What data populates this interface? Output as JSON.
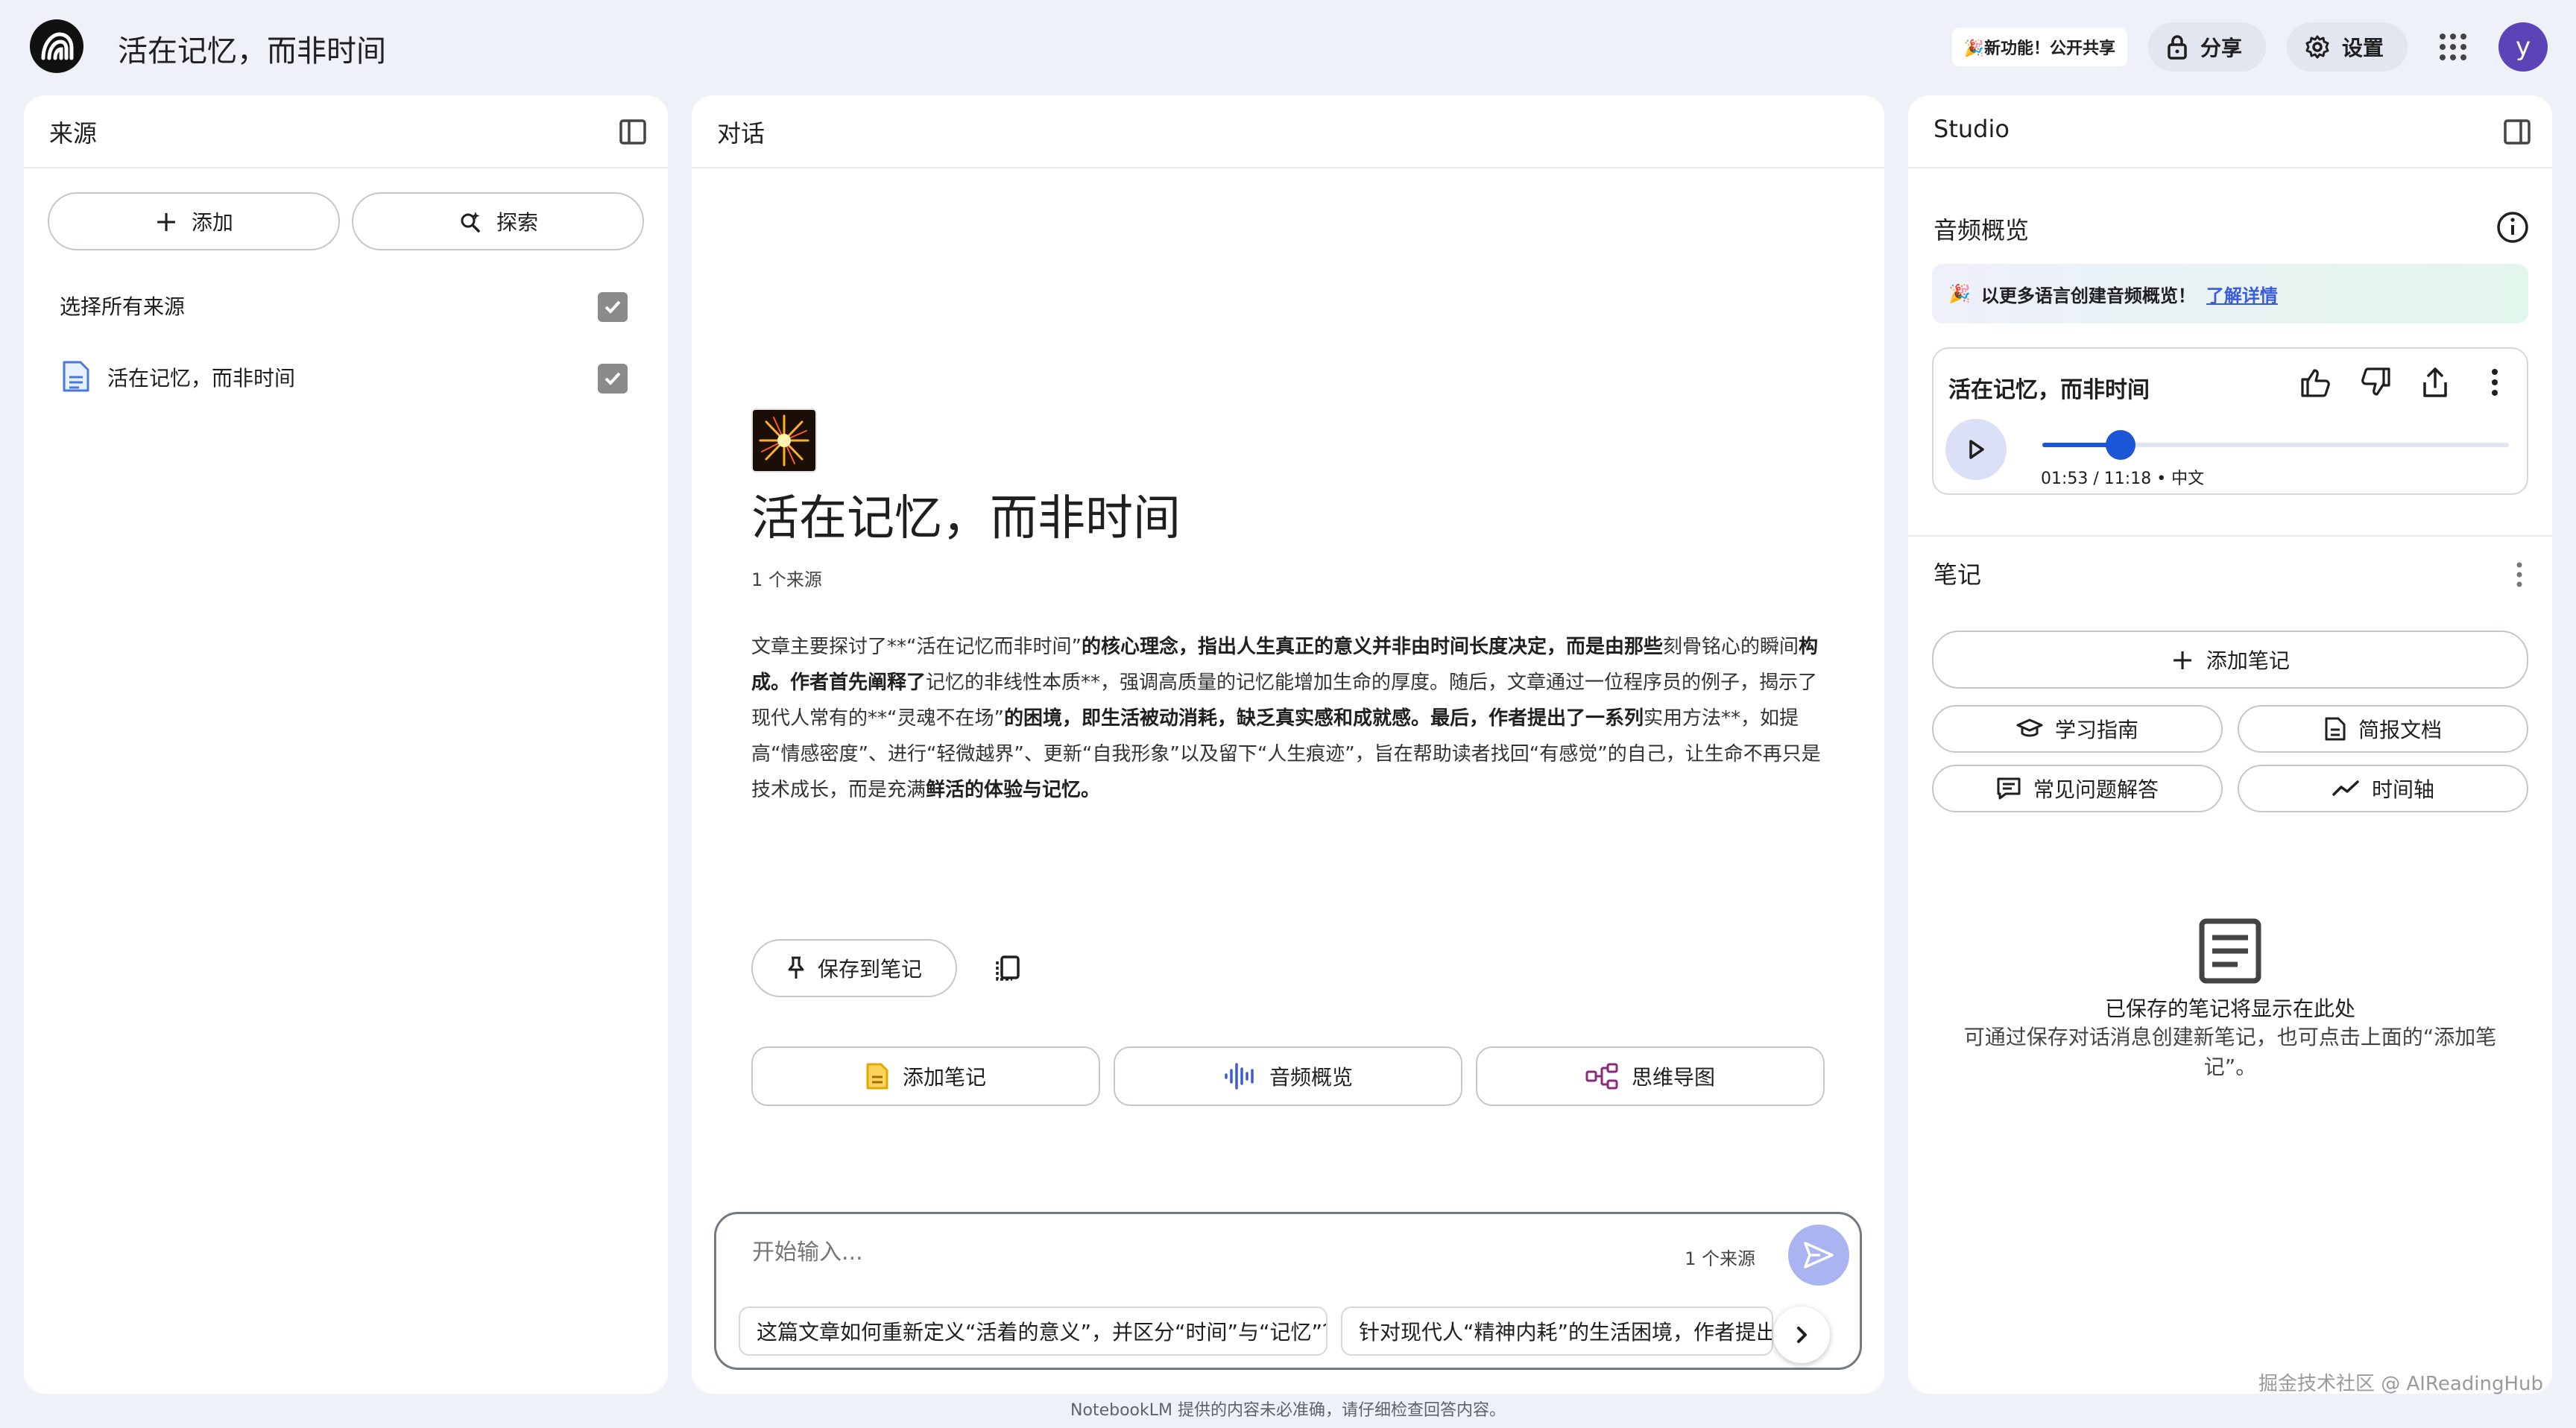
{
  "header": {
    "title": "活在记忆，而非时间",
    "promo": "🎉新功能！公开共享",
    "share_label": "分享",
    "settings_label": "设置",
    "avatar_letter": "y"
  },
  "sources": {
    "title": "来源",
    "add_label": "添加",
    "explore_label": "探索",
    "select_all_label": "选择所有来源",
    "items": [
      {
        "name": "活在记忆，而非时间",
        "checked": true
      }
    ]
  },
  "chat": {
    "title": "对话",
    "notebook_title": "活在记忆，而非时间",
    "source_count": "1 个来源",
    "save_label": "保存到笔记",
    "actions": [
      {
        "label": "添加笔记",
        "icon": "note-icon"
      },
      {
        "label": "音频概览",
        "icon": "audio-wave-icon"
      },
      {
        "label": "思维导图",
        "icon": "mind-map-icon"
      }
    ],
    "composer": {
      "placeholder": "开始输入...",
      "source_count": "1 个来源"
    },
    "suggestions": [
      "这篇文章如何重新定义“活着的意义”，并区分“时间”与“记忆”？",
      "针对现代人“精神内耗”的生活困境，作者提出"
    ]
  },
  "summary_parts": [
    {
      "t": "文章主要探讨了**“活在记忆而非时间”",
      "b": false
    },
    {
      "t": "的核心理念，指出人生真正的意义并非由时间长度决定，而是由那些",
      "b": true
    },
    {
      "t": "刻骨铭心的瞬间",
      "b": false
    },
    {
      "t": "构成。作者首先阐释了",
      "b": true
    },
    {
      "t": "记忆的非线性本质**，强调高质量的记忆能增加生命的厚度。随后，文章通过一位程序员的例子，揭示了现代人常有的**“灵魂不在场”",
      "b": false
    },
    {
      "t": "的困境，即生活被动消耗，缺乏真实感和成就感。最后，作者提出了一系列",
      "b": true
    },
    {
      "t": "实用方法**，如提高“情感密度”、进行“轻微越界”、更新“自我形象”以及留下“人生痕迹”，旨在帮助读者找回“有感觉”的自己，让生命不再只是技术成长，而是充满",
      "b": false
    },
    {
      "t": "鲜活的体验与记忆。",
      "b": true
    }
  ],
  "studio": {
    "title": "Studio",
    "audio_section_title": "音频概览",
    "banner_text": "以更多语言创建音频概览！",
    "banner_link": "了解详情",
    "audio": {
      "title": "活在记忆，而非时间",
      "time": "01:53 / 11:18 • 中文",
      "progress": 0.168
    },
    "notes_title": "笔记",
    "add_note_label": "添加笔记",
    "note_tools": [
      {
        "label": "学习指南",
        "icon": "graduation-cap-icon"
      },
      {
        "label": "简报文档",
        "icon": "doc-icon"
      },
      {
        "label": "常见问题解答",
        "icon": "faq-icon"
      },
      {
        "label": "时间轴",
        "icon": "timeline-icon"
      }
    ],
    "empty_title": "已保存的笔记将显示在此处",
    "empty_desc": "可通过保存对话消息创建新笔记，也可点击上面的“添加笔记”。"
  },
  "footer_note": "NotebookLM 提供的内容未必准确，请仔细检查回答内容。",
  "watermark": "掘金技术社区 @ AIReadingHub",
  "colors": {
    "background": "#eef1f8",
    "accent": "#1a56d6",
    "send": "#a9b4f0",
    "avatar": "#5b44b8"
  }
}
